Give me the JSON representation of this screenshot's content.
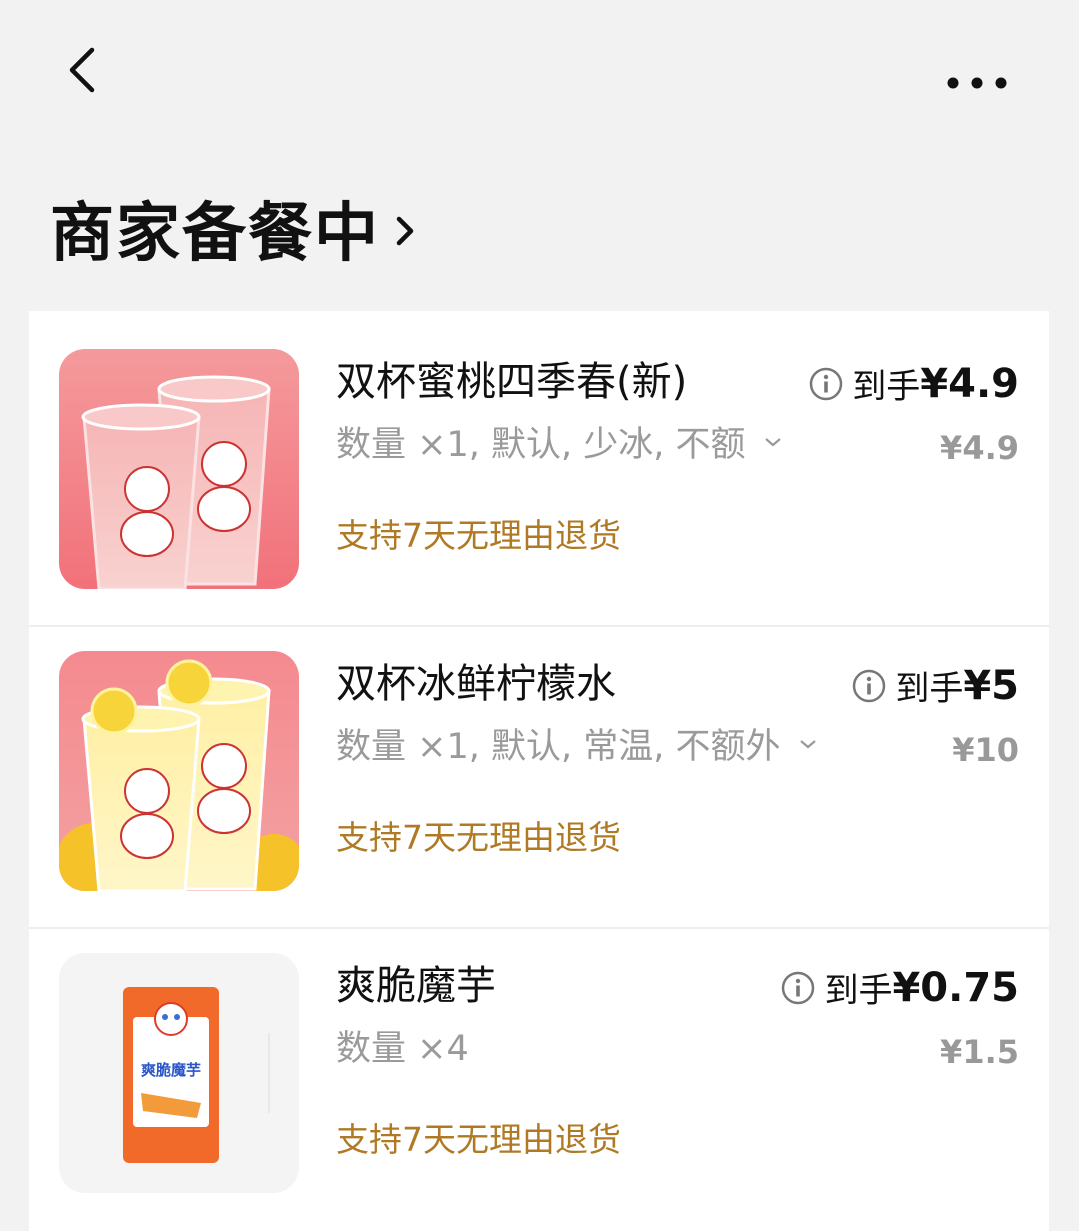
{
  "header": {
    "back_icon": "chevron-left-icon",
    "more_icon": "more-dots-icon"
  },
  "order_status": {
    "title": "商家备餐中",
    "chevron_icon": "chevron-right-icon"
  },
  "items": [
    {
      "name": "双杯蜜桃四季春(新)",
      "spec": "数量 ×1, 默认, 少冰, 不额",
      "refund_policy": "支持7天无理由退货",
      "price_label": "到手",
      "price": "¥4.9",
      "original_price": "¥4.9",
      "image": "peach-tea-cups"
    },
    {
      "name": "双杯冰鲜柠檬水",
      "spec": "数量 ×1, 默认, 常温, 不额外",
      "refund_policy": "支持7天无理由退货",
      "price_label": "到手",
      "price": "¥5",
      "original_price": "¥10",
      "image": "lemonade-cups"
    },
    {
      "name": "爽脆魔芋",
      "spec": "数量 ×4",
      "refund_policy": "支持7天无理由退货",
      "price_label": "到手",
      "price": "¥0.75",
      "original_price": "¥1.5",
      "image": "konjac-snack-pack",
      "package_text": "爽脆魔芋"
    }
  ],
  "colors": {
    "background": "#f2f2f2",
    "card": "#ffffff",
    "refund_text": "#b07a25",
    "secondary_text": "#9a9a9a"
  }
}
